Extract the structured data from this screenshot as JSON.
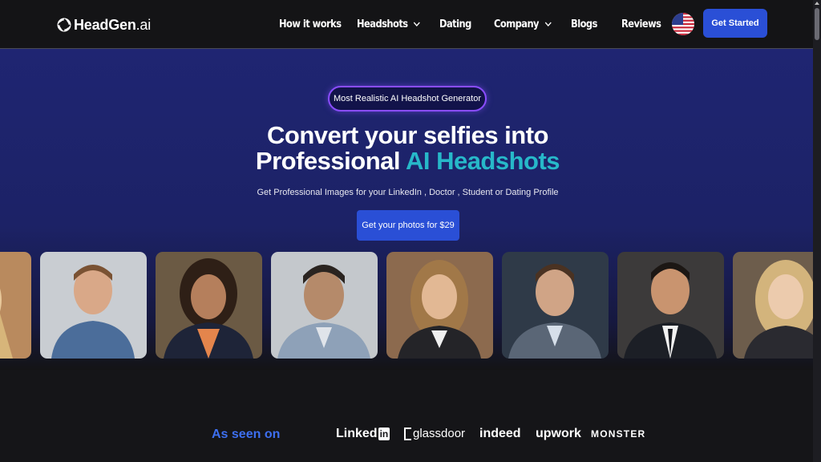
{
  "nav": {
    "logo_main": "HeadGen",
    "logo_suffix": ".ai",
    "links": [
      "How it works",
      "Headshots",
      "Dating",
      "Company",
      "Blogs",
      "Reviews"
    ],
    "cta": "Get Started"
  },
  "hero": {
    "badge": "Most Realistic AI Headshot Generator",
    "headline_line1": "Convert your selfies into",
    "headline_line2_plain": "Professional ",
    "headline_line2_accent": "AI Headshots",
    "subtext": "Get Professional Images for your LinkedIn , Doctor , Student or Dating Profile",
    "button": "Get your photos for $29"
  },
  "as_seen_on": {
    "label": "As seen on",
    "brands": [
      "Linked",
      "in",
      "glassdoor",
      "indeed",
      "upwork",
      "MONSTER"
    ]
  },
  "colors": {
    "accent": "#27b8c9",
    "primary_button": "#2a4fd6",
    "badge_border": "#8a4dff",
    "seen_label": "#3d6ff0"
  }
}
